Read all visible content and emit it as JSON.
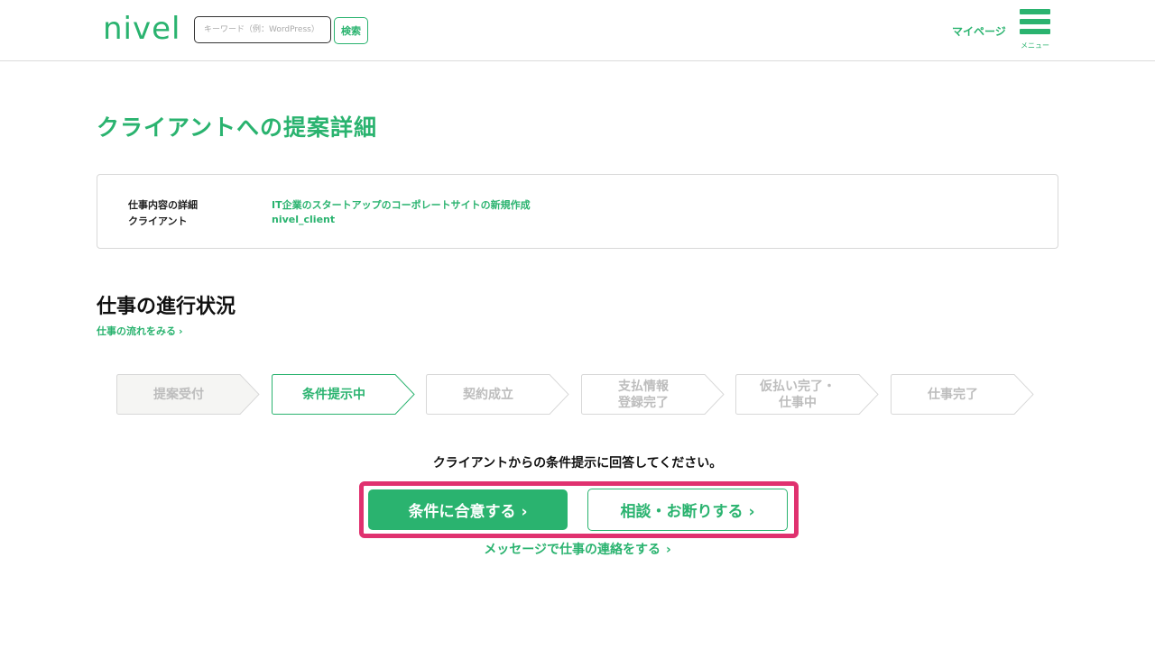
{
  "header": {
    "logo": "nivel",
    "search_placeholder": "キーワード（例：WordPress）",
    "search_button": "検索",
    "mypage": "マイページ",
    "menu_label": "メニュー"
  },
  "page_title": "クライアントへの提案詳細",
  "details": {
    "job_label": "仕事内容の詳細",
    "job_value": "IT企業のスタートアップのコーポレートサイトの新規作成",
    "client_label": "クライアント",
    "client_value": "nivel_client"
  },
  "progress": {
    "title": "仕事の進行状況",
    "flow_link": "仕事の流れをみる",
    "steps": [
      {
        "label": "提案受付",
        "state": "done"
      },
      {
        "label": "条件提示中",
        "state": "current"
      },
      {
        "label": "契約成立",
        "state": "todo"
      },
      {
        "label": "支払情報\n登録完了",
        "state": "todo"
      },
      {
        "label": "仮払い完了・\n仕事中",
        "state": "todo"
      },
      {
        "label": "仕事完了",
        "state": "todo"
      }
    ]
  },
  "action": {
    "instruction": "クライアントからの条件提示に回答してください。",
    "agree_button": "条件に合意する",
    "consult_button": "相談・お断りする",
    "message_link": "メッセージで仕事の連絡をする"
  },
  "colors": {
    "accent": "#2ab36f",
    "highlight": "#e0316f",
    "step_done_fill": "#f5f5f3",
    "border": "#d8d8d8"
  }
}
